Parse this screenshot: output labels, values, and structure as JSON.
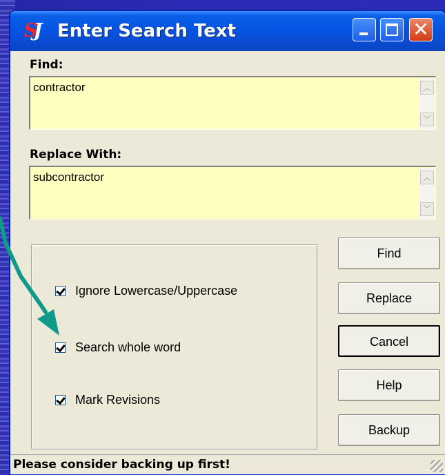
{
  "window": {
    "title": "Enter Search Text",
    "app_icon": "sj-logo-icon",
    "controls": [
      "minimize-icon",
      "maximize-icon",
      "close-icon"
    ],
    "close_glyph": "✕"
  },
  "find": {
    "label": "Find:",
    "value": "contractor"
  },
  "replace": {
    "label": "Replace With:",
    "value": "subcontractor"
  },
  "options": [
    {
      "label": "Ignore Lowercase/Uppercase",
      "checked": true
    },
    {
      "label": "Search whole word",
      "checked": true
    },
    {
      "label": "Mark Revisions",
      "checked": true
    }
  ],
  "buttons": {
    "find": "Find",
    "replace": "Replace",
    "cancel": "Cancel",
    "help": "Help",
    "backup": "Backup"
  },
  "status": "Please consider backing up first!",
  "colors": {
    "background": "#2b2bb8",
    "field_background": "#ffffc0",
    "annotation_arrow": "#0f9a8a"
  }
}
